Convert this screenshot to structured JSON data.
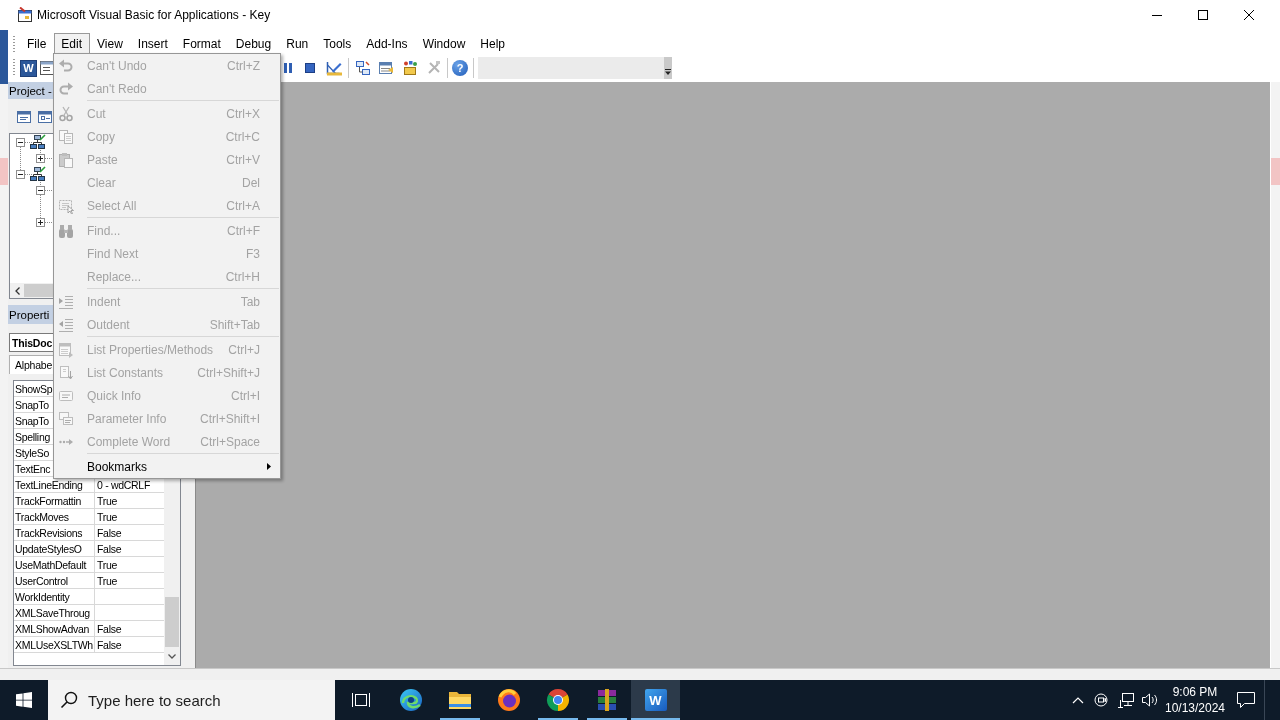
{
  "window": {
    "title": "Microsoft Visual Basic for Applications - Key"
  },
  "menu_bar": [
    {
      "label": "File",
      "selected": false
    },
    {
      "label": "Edit",
      "selected": true
    },
    {
      "label": "View",
      "selected": false
    },
    {
      "label": "Insert",
      "selected": false
    },
    {
      "label": "Format",
      "selected": false
    },
    {
      "label": "Debug",
      "selected": false
    },
    {
      "label": "Run",
      "selected": false
    },
    {
      "label": "Tools",
      "selected": false
    },
    {
      "label": "Add-Ins",
      "selected": false
    },
    {
      "label": "Window",
      "selected": false
    },
    {
      "label": "Help",
      "selected": false
    }
  ],
  "toolbar": {
    "word_button": {
      "glyph": "W"
    },
    "help_button": {
      "glyph": "?"
    }
  },
  "edit_menu": {
    "items": [
      {
        "kind": "command",
        "label": "Can't Undo",
        "shortcut": "Ctrl+Z",
        "disabled": true
      },
      {
        "kind": "command",
        "label": "Can't Redo",
        "disabled": true
      },
      {
        "kind": "separator"
      },
      {
        "kind": "command",
        "label": "Cut",
        "shortcut": "Ctrl+X",
        "disabled": true
      },
      {
        "kind": "command",
        "label": "Copy",
        "shortcut": "Ctrl+C",
        "disabled": true
      },
      {
        "kind": "command",
        "label": "Paste",
        "shortcut": "Ctrl+V",
        "disabled": true
      },
      {
        "kind": "command",
        "label": "Clear",
        "shortcut": "Del",
        "disabled": true
      },
      {
        "kind": "command",
        "label": "Select All",
        "shortcut": "Ctrl+A",
        "disabled": true
      },
      {
        "kind": "separator"
      },
      {
        "kind": "command",
        "label": "Find...",
        "shortcut": "Ctrl+F",
        "disabled": true
      },
      {
        "kind": "command",
        "label": "Find Next",
        "shortcut": "F3",
        "disabled": true
      },
      {
        "kind": "command",
        "label": "Replace...",
        "shortcut": "Ctrl+H",
        "disabled": true
      },
      {
        "kind": "separator"
      },
      {
        "kind": "command",
        "label": "Indent",
        "shortcut": "Tab",
        "disabled": true
      },
      {
        "kind": "command",
        "label": "Outdent",
        "shortcut": "Shift+Tab",
        "disabled": true
      },
      {
        "kind": "separator"
      },
      {
        "kind": "command",
        "label": "List Properties/Methods",
        "shortcut": "Ctrl+J",
        "disabled": true
      },
      {
        "kind": "command",
        "label": "List Constants",
        "shortcut": "Ctrl+Shift+J",
        "disabled": true
      },
      {
        "kind": "command",
        "label": "Quick Info",
        "shortcut": "Ctrl+I",
        "disabled": true
      },
      {
        "kind": "command",
        "label": "Parameter Info",
        "shortcut": "Ctrl+Shift+I",
        "disabled": true
      },
      {
        "kind": "command",
        "label": "Complete Word",
        "shortcut": "Ctrl+Space",
        "disabled": true
      },
      {
        "kind": "separator"
      },
      {
        "kind": "submenu",
        "label": "Bookmarks",
        "disabled": false
      }
    ]
  },
  "project_explorer": {
    "title": "Project -",
    "tree": [
      {
        "kind": "project",
        "expanded": true,
        "children": [
          {
            "kind": "folder",
            "expanded": false
          }
        ]
      },
      {
        "kind": "project",
        "expanded": true,
        "children": [
          {
            "kind": "folder",
            "expanded": true
          },
          {
            "kind": "folder",
            "expanded": false
          }
        ]
      }
    ]
  },
  "properties": {
    "title": "Properti",
    "object": "ThisDoc",
    "tabs": [
      {
        "label": "Alphabe",
        "selected": true
      }
    ],
    "rows": [
      {
        "name": "ShowSp"
      },
      {
        "name": "SnapTo"
      },
      {
        "name": "SnapTo"
      },
      {
        "name": "Spelling"
      },
      {
        "name": "StyleSo"
      },
      {
        "name": "TextEnc"
      },
      {
        "name": "TextLineEnding",
        "value": "0 - wdCRLF"
      },
      {
        "name": "TrackFormattin",
        "value": "True"
      },
      {
        "name": "TrackMoves",
        "value": "True"
      },
      {
        "name": "TrackRevisions",
        "value": "False"
      },
      {
        "name": "UpdateStylesO",
        "value": "False"
      },
      {
        "name": "UseMathDefault",
        "value": "True"
      },
      {
        "name": "UserControl",
        "value": "True"
      },
      {
        "name": "WorkIdentity"
      },
      {
        "name": "XMLSaveThroug"
      },
      {
        "name": "XMLShowAdvan",
        "value": "False"
      },
      {
        "name": "XMLUseXSLTWh",
        "value": "False"
      }
    ]
  },
  "taskbar": {
    "search": {
      "placeholder": "Type here to search"
    },
    "apps": [
      {
        "running": false,
        "selected": false
      },
      {
        "running": true,
        "selected": false
      },
      {
        "running": false,
        "selected": false
      },
      {
        "running": true,
        "selected": false
      },
      {
        "running": true,
        "selected": false
      },
      {
        "running": true,
        "selected": true,
        "glyph": "W"
      }
    ],
    "clock": {
      "time": "9:06 PM",
      "date": "10/13/2024"
    }
  }
}
